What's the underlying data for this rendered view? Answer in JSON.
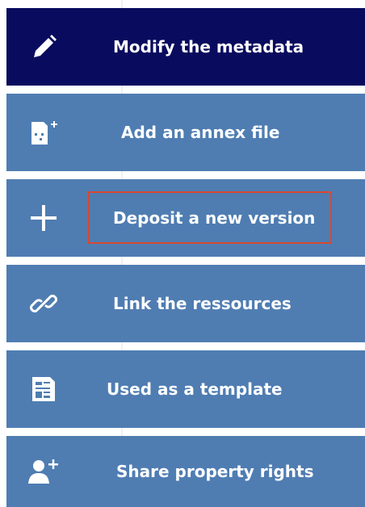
{
  "menu": {
    "items": [
      {
        "label": "Modify the metadata",
        "icon": "pencil-icon",
        "active": true
      },
      {
        "label": "Add an annex file",
        "icon": "file-add-icon",
        "active": false
      },
      {
        "label": "Deposit a new version",
        "icon": "plus-icon",
        "active": false,
        "highlighted": true
      },
      {
        "label": "Link the ressources",
        "icon": "link-icon",
        "active": false
      },
      {
        "label": "Used as a template",
        "icon": "template-icon",
        "active": false
      },
      {
        "label": "Share property rights",
        "icon": "user-add-icon",
        "active": false
      }
    ]
  },
  "colors": {
    "active_background": "#090b5e",
    "item_background": "#4f7db2",
    "label_text": "#ffffff",
    "highlight_border": "#d9482f"
  }
}
